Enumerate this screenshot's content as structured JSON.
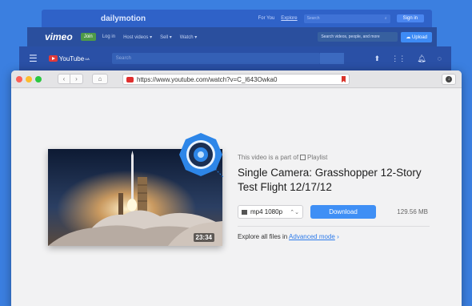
{
  "dailymotion": {
    "logo": "dailymotion",
    "nav": [
      "For You",
      "Explore"
    ],
    "search_placeholder": "Search",
    "signin": "Sign in"
  },
  "vimeo": {
    "logo": "vimeo",
    "join": "Join",
    "nav": [
      "Log in",
      "Host videos ▾",
      "Sell ▾",
      "Watch ▾"
    ],
    "search_placeholder": "Search videos, people, and more",
    "upload": "Upload"
  },
  "youtube": {
    "logo": "YouTube",
    "region": "UA",
    "search_placeholder": "Search"
  },
  "browser": {
    "url": "https://www.youtube.com/watch?v=C_l643Owka0"
  },
  "video": {
    "part_of_prefix": "This video is a part of",
    "part_of_suffix": "Playlist",
    "title": "Single Camera: Grasshopper 12-Story Test Flight 12/17/12",
    "duration": "23:34",
    "format": "mp4 1080p",
    "download_label": "Download",
    "size": "129.56 MB",
    "explore_prefix": "Explore all files in",
    "explore_link": "Advanced mode"
  },
  "colors": {
    "background": "#3b7fe0",
    "download_button": "#3f8ff5",
    "link": "#2e7bea",
    "badge": "#2d86e8"
  }
}
